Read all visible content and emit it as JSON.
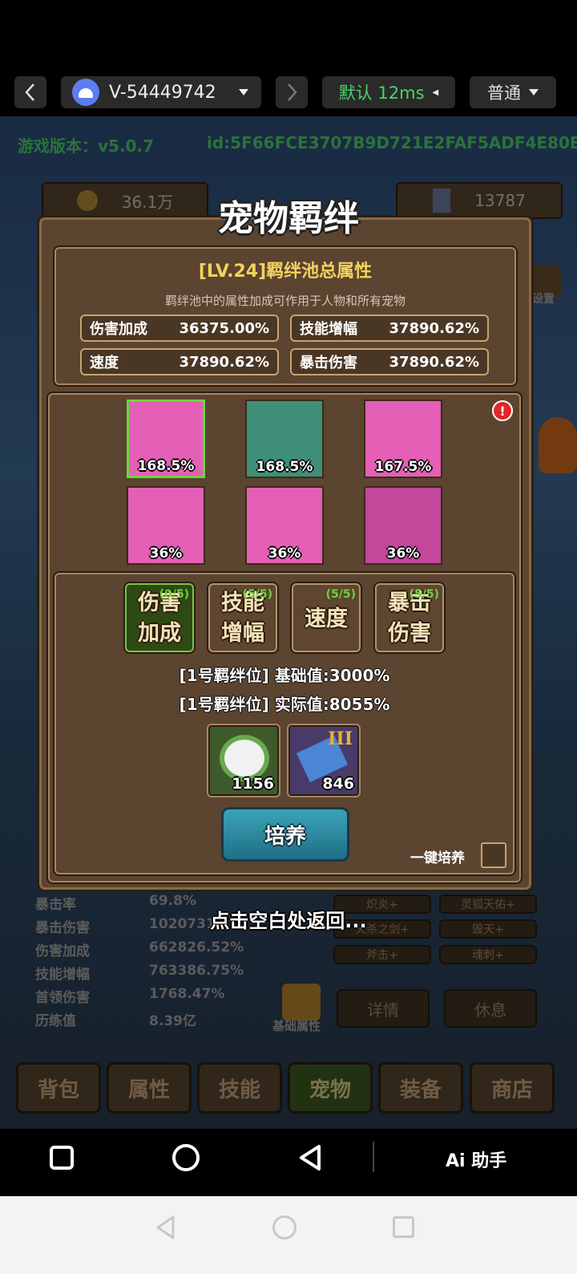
{
  "topbar": {
    "device_name": "V-54449742",
    "latency_label": "默认 12ms",
    "quality_label": "普通"
  },
  "game": {
    "version": "游戏版本：v5.0.7",
    "id": "id:5F66FCE3707B9D721E2FAF5ADF4E80BF",
    "coins": "36.1万",
    "gems": "13787",
    "right_label": "设置",
    "background_stats": [
      {
        "label": "暴击率",
        "value": "69.8%"
      },
      {
        "label": "暴击伤害",
        "value": "1020731.2%"
      },
      {
        "label": "伤害加成",
        "value": "662826.52%"
      },
      {
        "label": "技能增幅",
        "value": "763386.75%"
      },
      {
        "label": "首领伤害",
        "value": "1768.47%"
      },
      {
        "label": "历练值",
        "value": "8.39亿"
      }
    ],
    "background_buttons": [
      "炽炎+",
      "灵狐天佑+",
      "天杀之剑+",
      "毁天+",
      "斧击+",
      "魂刺+"
    ],
    "base_attr_label": "基础属性",
    "detail_label": "详情",
    "rest_label": "休息",
    "bottom_tabs": [
      "背包",
      "属性",
      "技能",
      "宠物",
      "装备",
      "商店"
    ],
    "active_tab": "宠物"
  },
  "dialog": {
    "title": "宠物羁绊",
    "pool_title": "[LV.24]羁绊池总属性",
    "pool_desc": "羁绊池中的属性加成可作用于人物和所有宠物",
    "stats": [
      {
        "label": "伤害加成",
        "value": "36375.00%"
      },
      {
        "label": "技能增幅",
        "value": "37890.62%"
      },
      {
        "label": "速度",
        "value": "37890.62%"
      },
      {
        "label": "暴击伤害",
        "value": "37890.62%"
      }
    ],
    "alert": "!",
    "pets": [
      {
        "pct": "168.5%",
        "color": "#e45fb5"
      },
      {
        "pct": "168.5%",
        "color": "#3f8f78"
      },
      {
        "pct": "167.5%",
        "color": "#e45fb5"
      },
      {
        "pct": "36%",
        "color": "#e45fb5"
      },
      {
        "pct": "36%",
        "color": "#e45fb5"
      },
      {
        "pct": "36%",
        "color": "#c3479b"
      }
    ],
    "bond_tabs": [
      {
        "line1": "伤害",
        "line2": "加成",
        "count": "(0/5)"
      },
      {
        "line1": "技能",
        "line2": "增幅",
        "count": "(5/5)"
      },
      {
        "line1": "速度",
        "line2": "",
        "count": "(5/5)"
      },
      {
        "line1": "暴击",
        "line2": "伤害",
        "count": "(5/5)"
      }
    ],
    "base_value": "[1号羁绊位] 基础值:3000%",
    "actual_value": "[1号羁绊位] 实际值:8055%",
    "items": [
      {
        "count": "1156",
        "icon": "cauliflower-icon"
      },
      {
        "count": "846",
        "icon": "scroll-icon",
        "tier": "III"
      }
    ],
    "cultivate_label": "培养",
    "onekey_label": "一键培养",
    "back_hint": "点击空白处返回..."
  },
  "navbar": {
    "ai_label": "Ai 助手"
  }
}
